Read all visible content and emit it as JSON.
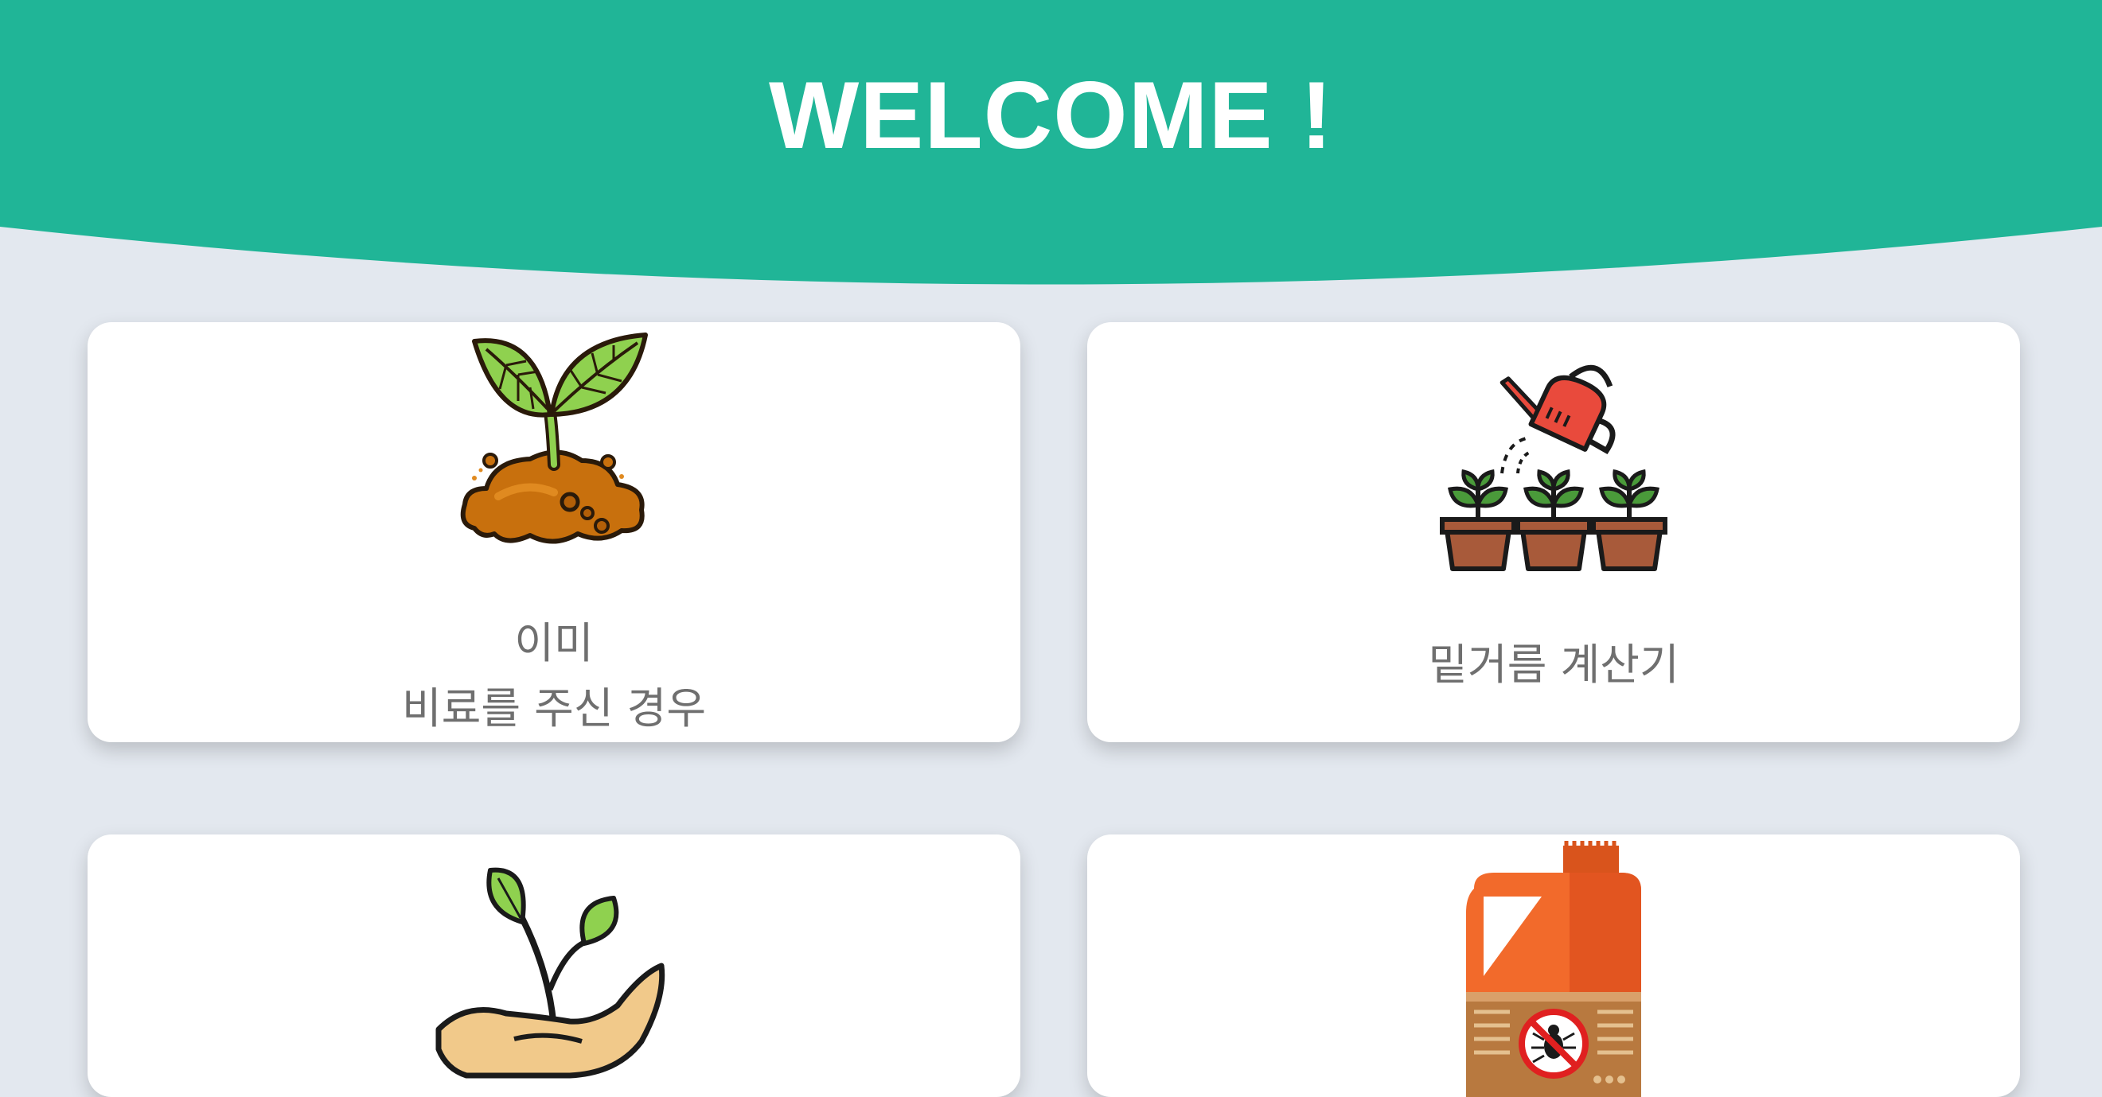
{
  "header": {
    "title": "WELCOME !",
    "color": "#20b597"
  },
  "cards": [
    {
      "label": "이미\n비료를 주신 경우",
      "icon": "seedling-soil-icon"
    },
    {
      "label": "밑거름 계산기",
      "icon": "watering-can-plants-icon"
    },
    {
      "label": "",
      "icon": "hand-sprout-icon"
    },
    {
      "label": "",
      "icon": "pesticide-jug-icon"
    }
  ],
  "colors": {
    "background": "#e3e8ef",
    "card": "#ffffff",
    "label_text": "#6f6f6f"
  }
}
